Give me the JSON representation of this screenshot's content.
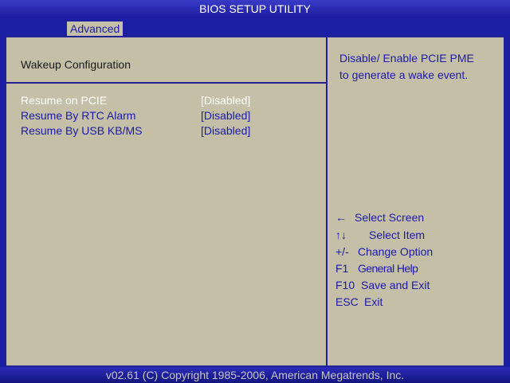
{
  "header": {
    "title": "BIOS SETUP UTILITY"
  },
  "tabs": [
    {
      "label": "Advanced",
      "active": true
    }
  ],
  "main": {
    "section_title": "Wakeup  Configuration",
    "options": [
      {
        "label": "Resume on PCIE",
        "value": "[Disabled]",
        "selected": true
      },
      {
        "label": "Resume By RTC Alarm",
        "value": "[Disabled]",
        "selected": false
      },
      {
        "label": "Resume By USB KB/MS",
        "value": "[Disabled]",
        "selected": false
      }
    ]
  },
  "help": {
    "line1": "Disable/ Enable PCIE PME",
    "line2": "to generate a wake event."
  },
  "keys": [
    {
      "key": "←",
      "desc": "Select Screen"
    },
    {
      "key": "↑↓",
      "desc": "Select Item"
    },
    {
      "key": "+/-",
      "desc": "Change Option"
    },
    {
      "key": "F1",
      "desc": "General Help"
    },
    {
      "key": "F10",
      "desc": "Save and Exit"
    },
    {
      "key": "ESC",
      "desc": "Exit"
    }
  ],
  "footer": {
    "copyright": "v02.61 (C) Copyright 1985-2006, American Megatrends, Inc."
  },
  "colors": {
    "background": "#1d1fa3",
    "panel": "#c5bfa8",
    "text_blue": "#1b1ba8",
    "selected_text": "#ffffff"
  }
}
